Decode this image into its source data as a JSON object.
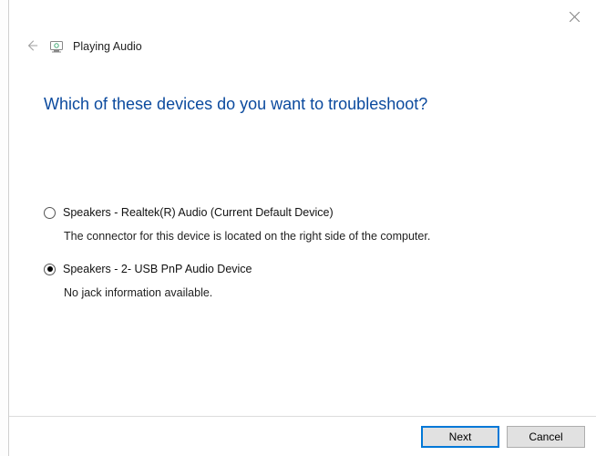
{
  "header": {
    "title": "Playing Audio"
  },
  "main": {
    "heading": "Which of these devices do you want to troubleshoot?"
  },
  "options": [
    {
      "label": "Speakers - Realtek(R) Audio (Current Default Device)",
      "description": "The connector for this device is located on the right side of the computer.",
      "selected": false
    },
    {
      "label": "Speakers - 2- USB PnP Audio Device",
      "description": "No jack information available.",
      "selected": true
    }
  ],
  "footer": {
    "next_label": "Next",
    "cancel_label": "Cancel"
  }
}
